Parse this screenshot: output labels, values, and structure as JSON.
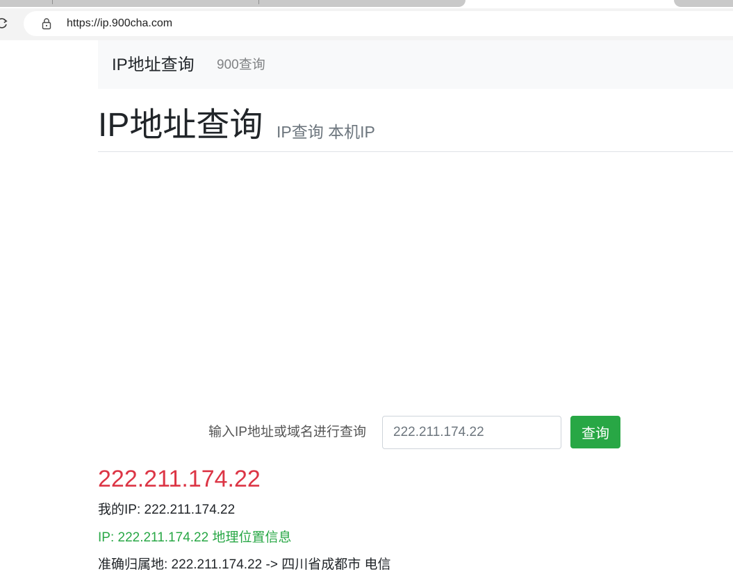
{
  "browser": {
    "url": "https://ip.900cha.com",
    "icons": {
      "reload": "reload-icon",
      "lock": "lock-icon"
    }
  },
  "navbar": {
    "brand": "IP地址查询",
    "link": "900查询"
  },
  "header": {
    "title": "IP地址查询",
    "subtitle": "IP查询 本机IP"
  },
  "query": {
    "label": "输入IP地址或域名进行查询",
    "input_value": "222.211.174.22",
    "button_label": "查询"
  },
  "result": {
    "ip": "222.211.174.22",
    "my_ip": "我的IP: 222.211.174.22",
    "geo_link": "IP: 222.211.174.22 地理位置信息",
    "location": "准确归属地: 222.211.174.22 -> 四川省成都市 电信"
  },
  "colors": {
    "accent_green": "#28a745",
    "ip_red": "#dc3545",
    "navbar_bg": "#f8f9fa",
    "muted_text": "#6c757d"
  }
}
